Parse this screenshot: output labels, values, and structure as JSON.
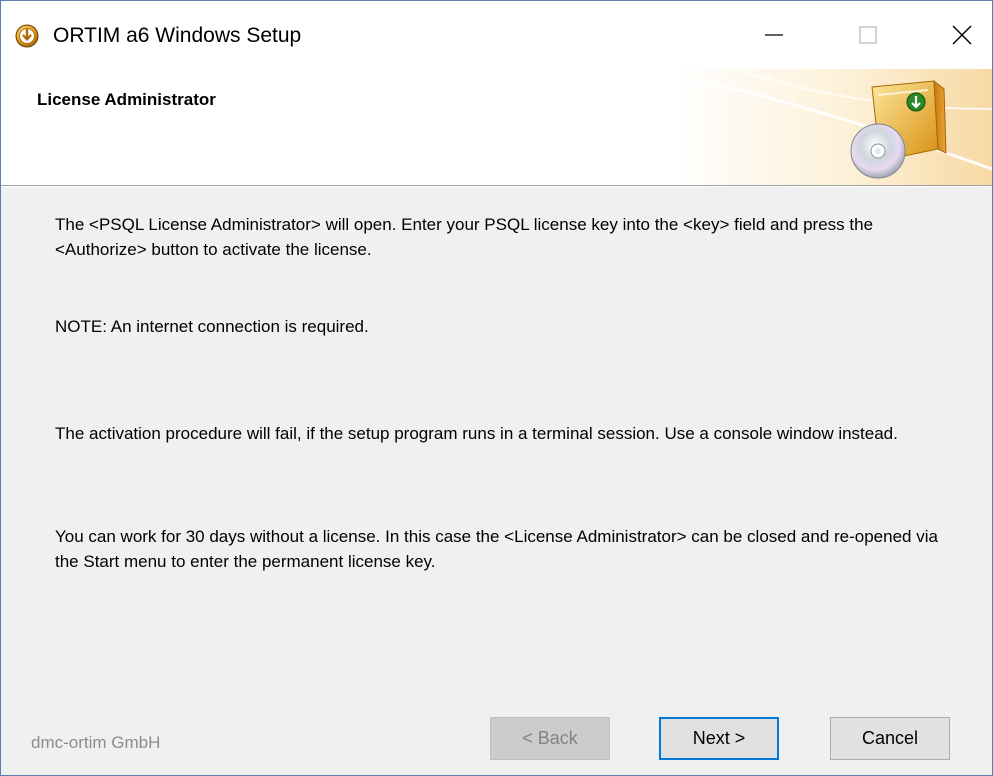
{
  "window": {
    "title": "ORTIM a6 Windows Setup",
    "icons": {
      "app": "setup-disc-icon",
      "minimize": "minimize-icon",
      "maximize": "maximize-icon",
      "close": "close-icon"
    }
  },
  "header": {
    "title": "License Administrator",
    "art_icon": "install-package-icon"
  },
  "body": {
    "paragraphs": [
      "The <PSQL License Administrator> will open. Enter your PSQL license key into the <key> field and press the <Authorize> button to activate the license.",
      "NOTE: An internet connection is required.",
      "The activation procedure will fail, if the setup program runs in a terminal session. Use a console window instead.",
      "You can work for 30 days without a license. In this case the <License Administrator> can be closed and re-opened via the Start menu to enter the permanent license key."
    ]
  },
  "footer": {
    "brand": "dmc-ortim GmbH",
    "buttons": {
      "back": "< Back",
      "next": "Next >",
      "cancel": "Cancel"
    }
  },
  "colors": {
    "window_border": "#5a7fa8",
    "body_background": "#f0f0f0",
    "focus_accent": "#0078d7",
    "brand_text": "#8c8c8c"
  }
}
